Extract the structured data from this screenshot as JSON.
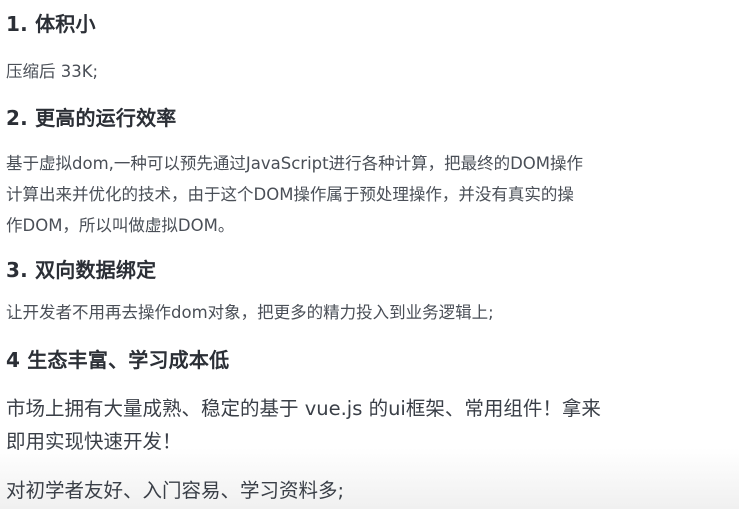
{
  "sections": [
    {
      "heading": "1. 体积小",
      "lines": [
        "压缩后 33K;"
      ]
    },
    {
      "heading": "2. 更高的运行效率",
      "lines": [
        "基于虚拟dom,一种可以预先通过JavaScript进行各种计算，把最终的DOM操作",
        "计算出来并优化的技术，由于这个DOM操作属于预处理操作，并没有真实的操",
        "作DOM，所以叫做虚拟DOM。"
      ]
    },
    {
      "heading": "3. 双向数据绑定",
      "lines": [
        "让开发者不用再去操作dom对象，把更多的精力投入到业务逻辑上;"
      ]
    },
    {
      "heading": "4 生态丰富、学习成本低",
      "lines": [
        "市场上拥有大量成熟、稳定的基于 vue.js 的ui框架、常用组件！拿来",
        "即用实现快速开发！"
      ],
      "extra_lines": [
        "对初学者友好、入门容易、学习资料多;"
      ]
    }
  ]
}
